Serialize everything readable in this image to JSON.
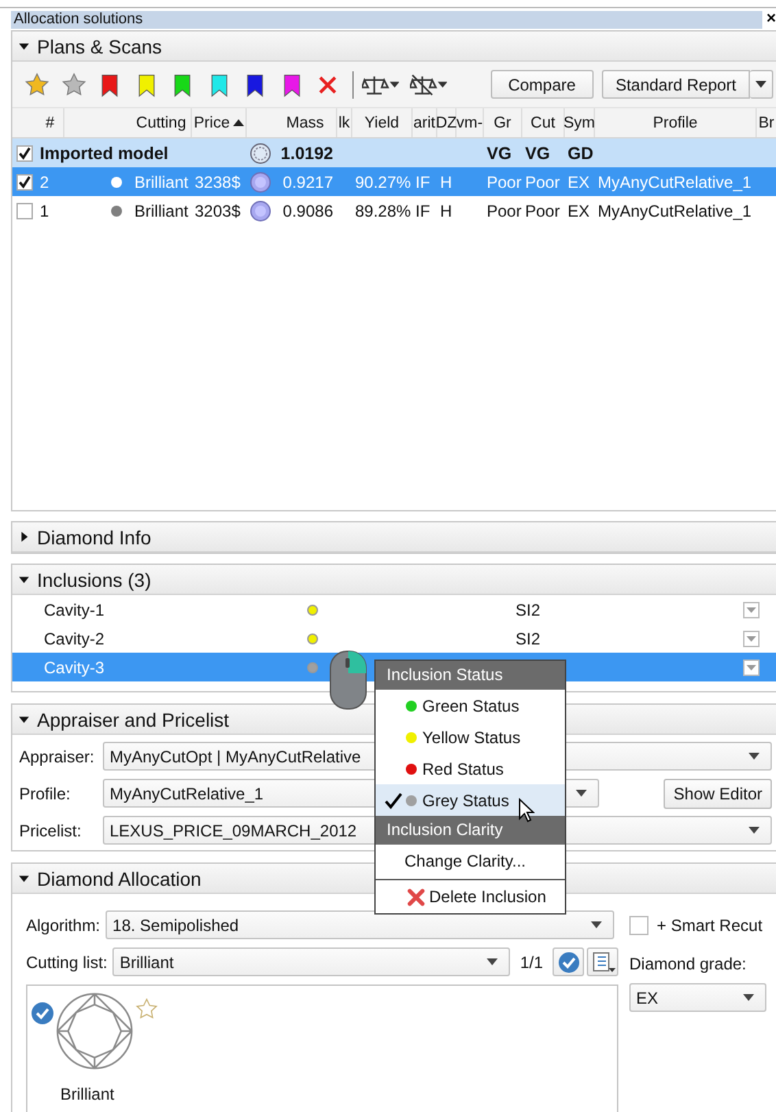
{
  "panel": {
    "title": "Allocation solutions",
    "close_label": "×"
  },
  "plans": {
    "title": "Plans & Scans",
    "expanded": true,
    "toolbar": [
      {
        "kind": "star",
        "color": "#f0b820"
      },
      {
        "kind": "star",
        "color": "#b8b8b8"
      },
      {
        "kind": "flag",
        "color": "#e81818"
      },
      {
        "kind": "flag",
        "color": "#f0f000"
      },
      {
        "kind": "flag",
        "color": "#18d818"
      },
      {
        "kind": "flag",
        "color": "#20e8e8"
      },
      {
        "kind": "flag",
        "color": "#1818e0"
      },
      {
        "kind": "flag",
        "color": "#e818e8"
      },
      {
        "kind": "delete"
      },
      {
        "kind": "separator"
      },
      {
        "kind": "balance"
      },
      {
        "kind": "balance-off"
      }
    ],
    "buttons": [
      {
        "label": "Compare",
        "kind": "plain"
      },
      {
        "label": "Standard Report",
        "kind": "split"
      }
    ],
    "columns": [
      {
        "label": "#",
        "sorted": false
      },
      {
        "label": "Cutting",
        "sorted": false
      },
      {
        "label": "Price",
        "sorted": true
      },
      {
        "label": "Mass",
        "sorted": false
      },
      {
        "label": "lk",
        "sorted": false
      },
      {
        "label": "Yield",
        "sorted": false
      },
      {
        "label": "arit",
        "sorted": false
      },
      {
        "label": "DZ",
        "sorted": false
      },
      {
        "label": "vm-",
        "sorted": false
      },
      {
        "label": "Gr",
        "sorted": false
      },
      {
        "label": "Cut",
        "sorted": false
      },
      {
        "label": "Sym",
        "sorted": false
      },
      {
        "label": "Profile",
        "sorted": false
      },
      {
        "label": "Br",
        "sorted": false
      }
    ],
    "rows": [
      {
        "kind": "model",
        "checked": true,
        "selected": false,
        "name": "Imported model",
        "mass": "1.0192",
        "gr": "VG",
        "cut": "VG",
        "sym": "GD"
      },
      {
        "kind": "plan",
        "checked": true,
        "selected": true,
        "num": "2",
        "color": "#ffffff",
        "cutting": "Brilliant",
        "price": "3238$",
        "mass": "0.9217",
        "yield": "90.27%",
        "clarity": "IF",
        "color_grade": "H",
        "gr": "Poor",
        "cut": "Poor",
        "sym": "EX",
        "profile": "MyAnyCutRelative_1"
      },
      {
        "kind": "plan",
        "checked": false,
        "selected": false,
        "num": "1",
        "color": "#808080",
        "cutting": "Brilliant",
        "price": "3203$",
        "mass": "0.9086",
        "yield": "89.28%",
        "clarity": "IF",
        "color_grade": "H",
        "gr": "Poor",
        "cut": "Poor",
        "sym": "EX",
        "profile": "MyAnyCutRelative_1"
      }
    ]
  },
  "diamond_info": {
    "title": "Diamond Info",
    "expanded": false
  },
  "inclusions": {
    "title": "Inclusions (3)",
    "expanded": true,
    "rows": [
      {
        "name": "Cavity-1",
        "color": "#f0f000",
        "clarity": "SI2",
        "selected": false
      },
      {
        "name": "Cavity-2",
        "color": "#f0f000",
        "clarity": "SI2",
        "selected": false
      },
      {
        "name": "Cavity-3",
        "color": "#a0a0a0",
        "selected": true
      }
    ]
  },
  "appraiser": {
    "title": "Appraiser and Pricelist",
    "expanded": true,
    "fields": [
      {
        "label": "Appraiser:",
        "value": "MyAnyCutOpt | MyAnyCutRelative"
      },
      {
        "label": "Profile:",
        "value": "MyAnyCutRelative_1",
        "button": "Show Editor"
      },
      {
        "label": "Pricelist:",
        "value": "LEXUS_PRICE_09MARCH_2012"
      }
    ]
  },
  "allocation": {
    "title": "Diamond Allocation",
    "expanded": true,
    "algorithm_label": "Algorithm:",
    "algorithm": "18. Semipolished",
    "smart_recut": {
      "label": "+ Smart Recut",
      "checked": false
    },
    "cutting_label": "Cutting list:",
    "cutting": "Brilliant",
    "counter": "1/1",
    "grade_label": "Diamond grade:",
    "grade": "EX",
    "cuts": [
      {
        "name": "Brilliant",
        "checked": true,
        "starred": false
      }
    ]
  },
  "context_menu": {
    "items": [
      {
        "kind": "header",
        "label": "Inclusion Status"
      },
      {
        "kind": "status",
        "label": "Green Status",
        "color": "#22d022",
        "checked": false,
        "highlighted": false
      },
      {
        "kind": "status",
        "label": "Yellow Status",
        "color": "#f0f000",
        "checked": false,
        "highlighted": false
      },
      {
        "kind": "status",
        "label": "Red Status",
        "color": "#e01010",
        "checked": false,
        "highlighted": false
      },
      {
        "kind": "status",
        "label": "Grey Status",
        "color": "#a0a0a0",
        "checked": true,
        "highlighted": true
      },
      {
        "kind": "header",
        "label": "Inclusion Clarity"
      },
      {
        "kind": "action",
        "label": "Change Clarity..."
      },
      {
        "kind": "separator"
      },
      {
        "kind": "delete",
        "label": "Delete Inclusion"
      }
    ]
  }
}
